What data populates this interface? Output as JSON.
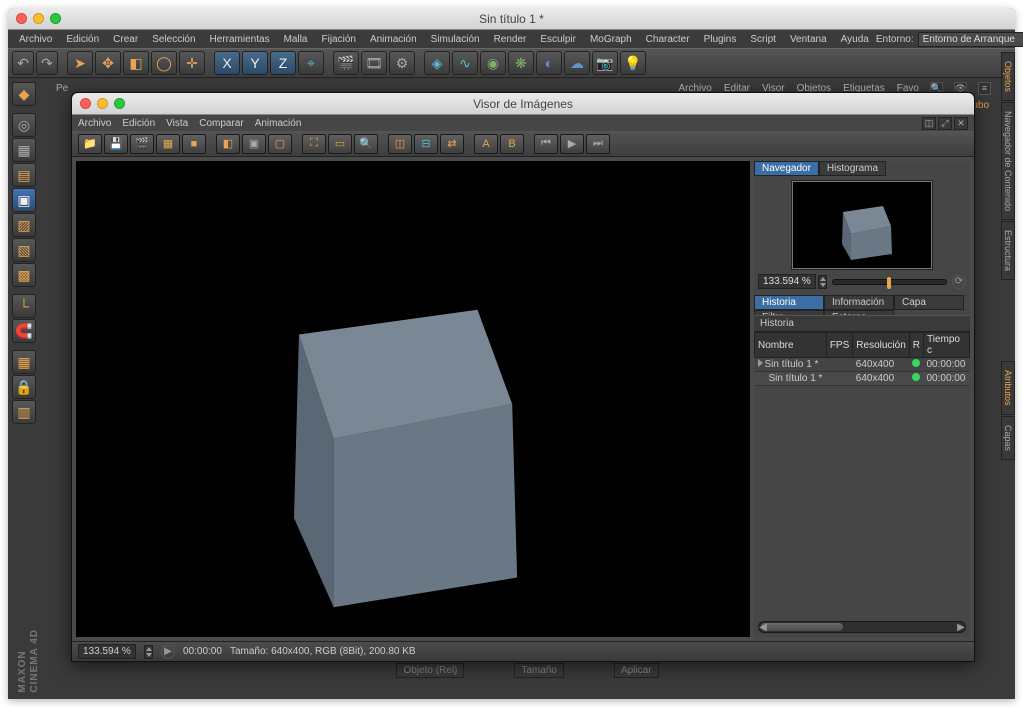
{
  "app": {
    "main_title": "Sin título 1 *",
    "viewer_title": "Visor de Imágenes",
    "branding_line1": "MAXON",
    "branding_line2": "CINEMA 4D"
  },
  "main_menu": [
    "Archivo",
    "Edición",
    "Crear",
    "Selección",
    "Herramientas",
    "Malla",
    "Fijación",
    "Animación",
    "Simulación",
    "Render",
    "Esculpir",
    "MoGraph",
    "Character",
    "Plugins",
    "Script",
    "Ventana",
    "Ayuda"
  ],
  "env": {
    "label": "Entorno:",
    "value": "Entorno de Arranque"
  },
  "right_tabs": [
    "Objetos",
    "Navegador de Contenido",
    "Estructura",
    "Atributos",
    "Capas"
  ],
  "under": {
    "pe": "Pe",
    "sub_menus": [
      "Archivo",
      "Editar",
      "Visor",
      "Objetos",
      "Etiquetas",
      "Favo"
    ],
    "cube_label": "Cubo"
  },
  "viewer_menu": [
    "Archivo",
    "Edición",
    "Vista",
    "Comparar",
    "Animación"
  ],
  "side": {
    "tab_navegador": "Navegador",
    "tab_histograma": "Histograma",
    "zoom_value": "133.594 %",
    "tab_historia": "Historia",
    "tab_informacion": "Información",
    "tab_capa": "Capa",
    "tab_filtro": "Filtro",
    "tab_estereo": "Estereo",
    "section_historia": "Historia",
    "col_nombre": "Nombre",
    "col_fps": "FPS",
    "col_resolucion": "Resolución",
    "col_r": "R",
    "col_tiempo": "Tiempo c",
    "rows": [
      {
        "name": "Sin título 1 *",
        "fps": "",
        "res": "640x400",
        "time": "00:00:00"
      },
      {
        "name": "Sin título 1 *",
        "fps": "",
        "res": "640x400",
        "time": "00:00:00"
      }
    ]
  },
  "status": {
    "zoom": "133.594 %",
    "time": "00:00:00",
    "info": "Tamaño: 640x400, RGB (8Bit), 200.80 KB"
  },
  "bg_bottom": {
    "objeto": "Objeto (Rel)",
    "tamano": "Tamaño",
    "aplicar": "Aplicar"
  },
  "icons": {
    "undo": "undo-icon",
    "redo": "redo-icon",
    "cursor": "cursor-icon",
    "move": "move-icon",
    "cube": "cube-icon",
    "rotate": "rotate-icon",
    "scale": "scale-icon",
    "x": "x-axis-icon",
    "y": "y-axis-icon",
    "z": "z-axis-icon",
    "render": "render-icon",
    "renderreg": "render-region-icon",
    "rendersettings": "render-settings-icon",
    "prim": "primitive-icon",
    "spline": "spline-icon",
    "nurbs": "nurbs-icon",
    "array": "array-icon",
    "deform": "deformer-icon",
    "env": "environment-icon",
    "cam": "camera-icon",
    "light": "light-icon"
  }
}
